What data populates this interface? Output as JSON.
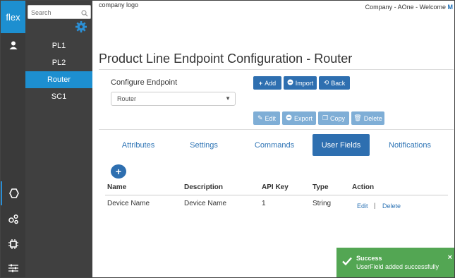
{
  "colors": {
    "accent": "#1d8fd0",
    "button": "#2e6fb0",
    "button_disabled": "#7faed6",
    "success": "#53a653",
    "rail_bg": "#3a3a3a",
    "sidebar_bg": "#404040"
  },
  "rail": {
    "logo": "flex",
    "icons": [
      "user-icon",
      "hexagon-icon",
      "share-nodes-icon",
      "chip-icon",
      "sliders-icon"
    ],
    "active_icon": "hexagon-icon"
  },
  "sidebar": {
    "search_placeholder": "Search",
    "items": [
      {
        "label": "PL1",
        "active": false
      },
      {
        "label": "PL2",
        "active": false
      },
      {
        "label": "Router",
        "active": true
      },
      {
        "label": "SC1",
        "active": false
      }
    ]
  },
  "header": {
    "logo_text": "company logo",
    "welcome_text": "Company - AOne - Welcome ",
    "welcome_user": "M"
  },
  "page": {
    "title": "Product Line Endpoint Configuration - Router"
  },
  "configure": {
    "label": "Configure Endpoint",
    "select_value": "Router"
  },
  "toolbar": {
    "add": "Add",
    "import": "Import",
    "back": "Back",
    "edit": "Edit",
    "export": "Export",
    "copy": "Copy",
    "delete": "Delete"
  },
  "tabs": [
    {
      "label": "Attributes",
      "active": false
    },
    {
      "label": "Settings",
      "active": false
    },
    {
      "label": "Commands",
      "active": false
    },
    {
      "label": "User Fields",
      "active": true
    },
    {
      "label": "Notifications",
      "active": false
    }
  ],
  "table": {
    "headers": [
      "Name",
      "Description",
      "API Key",
      "Type",
      "Action"
    ],
    "rows": [
      {
        "name": "Device Name",
        "description": "Device Name",
        "api_key": "1",
        "type": "String",
        "edit": "Edit",
        "separator": "|",
        "delete": "Delete"
      }
    ]
  },
  "toast": {
    "title": "Success",
    "message": "UserField added successfully",
    "close": "×"
  }
}
